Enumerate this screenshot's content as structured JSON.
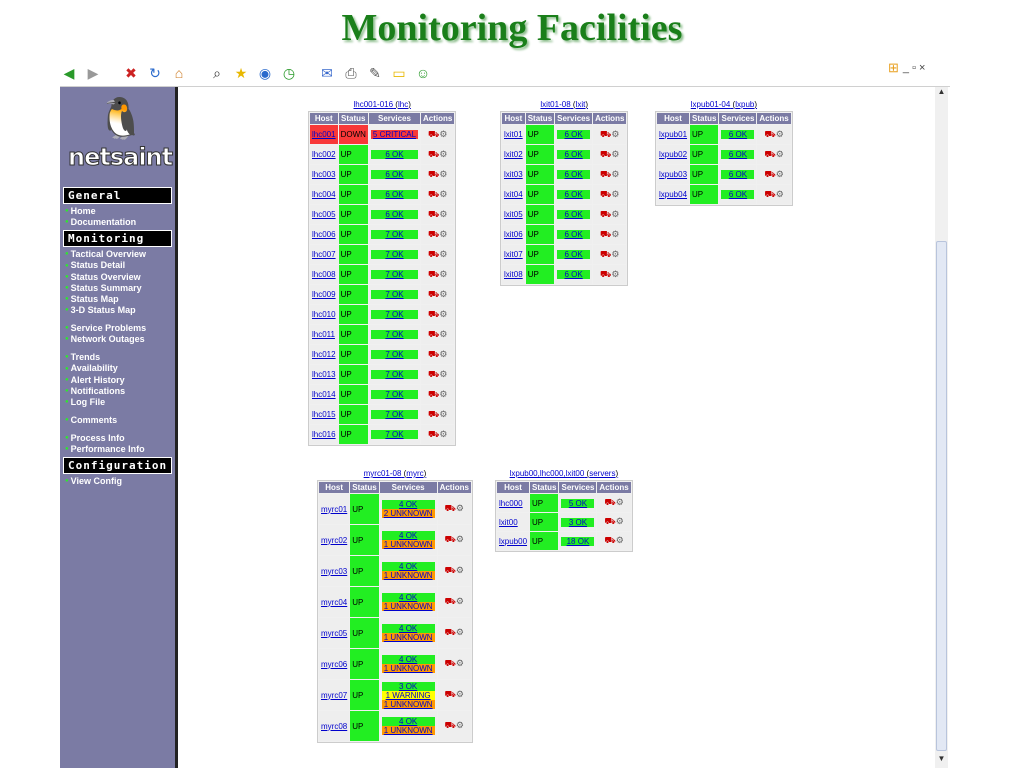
{
  "slide_title": "Monitoring Facilities",
  "toolbar": {
    "icons": [
      "back-icon",
      "forward-icon",
      "stop-icon",
      "refresh-icon",
      "home-icon",
      "search-icon",
      "favorites-icon",
      "media-icon",
      "history-icon",
      "mail-icon",
      "print-icon",
      "edit-icon",
      "discuss-icon",
      "messenger-icon"
    ],
    "window_controls": "_ ▫ ×"
  },
  "sidebar": {
    "logo_text": "netsaint",
    "sections": [
      {
        "header": "General",
        "items": [
          "Home",
          "Documentation"
        ]
      },
      {
        "header": "Monitoring",
        "items": [
          "Tactical Overview",
          "Status Detail",
          "Status Overview",
          "Status Summary",
          "Status Map",
          "3-D Status Map",
          "",
          "Service Problems",
          "Network Outages",
          "",
          "Trends",
          "Availability",
          "Alert History",
          "Notifications",
          "Log File",
          "",
          "Comments",
          "",
          "Process Info",
          "Performance Info"
        ]
      },
      {
        "header": "Configuration",
        "items": [
          "View Config"
        ]
      }
    ]
  },
  "headers": {
    "host": "Host",
    "status": "Status",
    "services": "Services",
    "actions": "Actions"
  },
  "groups": [
    {
      "title": "lhc001-016",
      "alias": "lhc",
      "rows": [
        {
          "host": "lhc001",
          "status": "DOWN",
          "services": [
            {
              "text": "5 CRITICAL",
              "state": "crit"
            }
          ]
        },
        {
          "host": "lhc002",
          "status": "UP",
          "services": [
            {
              "text": "6 OK",
              "state": "ok"
            }
          ]
        },
        {
          "host": "lhc003",
          "status": "UP",
          "services": [
            {
              "text": "6 OK",
              "state": "ok"
            }
          ]
        },
        {
          "host": "lhc004",
          "status": "UP",
          "services": [
            {
              "text": "6 OK",
              "state": "ok"
            }
          ]
        },
        {
          "host": "lhc005",
          "status": "UP",
          "services": [
            {
              "text": "6 OK",
              "state": "ok"
            }
          ]
        },
        {
          "host": "lhc006",
          "status": "UP",
          "services": [
            {
              "text": "7 OK",
              "state": "ok"
            }
          ]
        },
        {
          "host": "lhc007",
          "status": "UP",
          "services": [
            {
              "text": "7 OK",
              "state": "ok"
            }
          ]
        },
        {
          "host": "lhc008",
          "status": "UP",
          "services": [
            {
              "text": "7 OK",
              "state": "ok"
            }
          ]
        },
        {
          "host": "lhc009",
          "status": "UP",
          "services": [
            {
              "text": "7 OK",
              "state": "ok"
            }
          ]
        },
        {
          "host": "lhc010",
          "status": "UP",
          "services": [
            {
              "text": "7 OK",
              "state": "ok"
            }
          ]
        },
        {
          "host": "lhc011",
          "status": "UP",
          "services": [
            {
              "text": "7 OK",
              "state": "ok"
            }
          ]
        },
        {
          "host": "lhc012",
          "status": "UP",
          "services": [
            {
              "text": "7 OK",
              "state": "ok"
            }
          ]
        },
        {
          "host": "lhc013",
          "status": "UP",
          "services": [
            {
              "text": "7 OK",
              "state": "ok"
            }
          ]
        },
        {
          "host": "lhc014",
          "status": "UP",
          "services": [
            {
              "text": "7 OK",
              "state": "ok"
            }
          ]
        },
        {
          "host": "lhc015",
          "status": "UP",
          "services": [
            {
              "text": "7 OK",
              "state": "ok"
            }
          ]
        },
        {
          "host": "lhc016",
          "status": "UP",
          "services": [
            {
              "text": "7 OK",
              "state": "ok"
            }
          ]
        }
      ]
    },
    {
      "title": "lxit01-08",
      "alias": "lxit",
      "rows": [
        {
          "host": "lxit01",
          "status": "UP",
          "services": [
            {
              "text": "6 OK",
              "state": "ok"
            }
          ]
        },
        {
          "host": "lxit02",
          "status": "UP",
          "services": [
            {
              "text": "6 OK",
              "state": "ok"
            }
          ]
        },
        {
          "host": "lxit03",
          "status": "UP",
          "services": [
            {
              "text": "6 OK",
              "state": "ok"
            }
          ]
        },
        {
          "host": "lxit04",
          "status": "UP",
          "services": [
            {
              "text": "6 OK",
              "state": "ok"
            }
          ]
        },
        {
          "host": "lxit05",
          "status": "UP",
          "services": [
            {
              "text": "6 OK",
              "state": "ok"
            }
          ]
        },
        {
          "host": "lxit06",
          "status": "UP",
          "services": [
            {
              "text": "6 OK",
              "state": "ok"
            }
          ]
        },
        {
          "host": "lxit07",
          "status": "UP",
          "services": [
            {
              "text": "6 OK",
              "state": "ok"
            }
          ]
        },
        {
          "host": "lxit08",
          "status": "UP",
          "services": [
            {
              "text": "6 OK",
              "state": "ok"
            }
          ]
        }
      ]
    },
    {
      "title": "lxpub01-04",
      "alias": "lxpub",
      "rows": [
        {
          "host": "lxpub01",
          "status": "UP",
          "services": [
            {
              "text": "6 OK",
              "state": "ok"
            }
          ]
        },
        {
          "host": "lxpub02",
          "status": "UP",
          "services": [
            {
              "text": "6 OK",
              "state": "ok"
            }
          ]
        },
        {
          "host": "lxpub03",
          "status": "UP",
          "services": [
            {
              "text": "6 OK",
              "state": "ok"
            }
          ]
        },
        {
          "host": "lxpub04",
          "status": "UP",
          "services": [
            {
              "text": "6 OK",
              "state": "ok"
            }
          ]
        }
      ]
    },
    {
      "title": "myrc01-08",
      "alias": "myrc",
      "rows": [
        {
          "host": "myrc01",
          "status": "UP",
          "services": [
            {
              "text": "4 OK",
              "state": "ok"
            },
            {
              "text": "2 UNKNOWN",
              "state": "unk"
            }
          ]
        },
        {
          "host": "myrc02",
          "status": "UP",
          "services": [
            {
              "text": "4 OK",
              "state": "ok"
            },
            {
              "text": "1 UNKNOWN",
              "state": "unk"
            }
          ]
        },
        {
          "host": "myrc03",
          "status": "UP",
          "services": [
            {
              "text": "4 OK",
              "state": "ok"
            },
            {
              "text": "1 UNKNOWN",
              "state": "unk"
            }
          ]
        },
        {
          "host": "myrc04",
          "status": "UP",
          "services": [
            {
              "text": "4 OK",
              "state": "ok"
            },
            {
              "text": "1 UNKNOWN",
              "state": "unk"
            }
          ]
        },
        {
          "host": "myrc05",
          "status": "UP",
          "services": [
            {
              "text": "4 OK",
              "state": "ok"
            },
            {
              "text": "1 UNKNOWN",
              "state": "unk"
            }
          ]
        },
        {
          "host": "myrc06",
          "status": "UP",
          "services": [
            {
              "text": "4 OK",
              "state": "ok"
            },
            {
              "text": "1 UNKNOWN",
              "state": "unk"
            }
          ]
        },
        {
          "host": "myrc07",
          "status": "UP",
          "services": [
            {
              "text": "3 OK",
              "state": "ok"
            },
            {
              "text": "1 WARNING",
              "state": "warn"
            },
            {
              "text": "1 UNKNOWN",
              "state": "unk"
            }
          ]
        },
        {
          "host": "myrc08",
          "status": "UP",
          "services": [
            {
              "text": "4 OK",
              "state": "ok"
            },
            {
              "text": "1 UNKNOWN",
              "state": "unk"
            }
          ]
        }
      ]
    },
    {
      "title": "lxpub00,lhc000,lxit00",
      "alias": "servers",
      "rows": [
        {
          "host": "lhc000",
          "status": "UP",
          "services": [
            {
              "text": "5 OK",
              "state": "ok"
            }
          ]
        },
        {
          "host": "lxit00",
          "status": "UP",
          "services": [
            {
              "text": "3 OK",
              "state": "ok"
            }
          ]
        },
        {
          "host": "lxpub00",
          "status": "UP",
          "services": [
            {
              "text": "18 OK",
              "state": "ok"
            }
          ]
        }
      ]
    }
  ],
  "colors": {
    "ok": "#22ee22",
    "critical": "#f83838",
    "unknown": "#ff9900",
    "warning": "#ffff00",
    "sidebar": "#7b7ba4"
  }
}
